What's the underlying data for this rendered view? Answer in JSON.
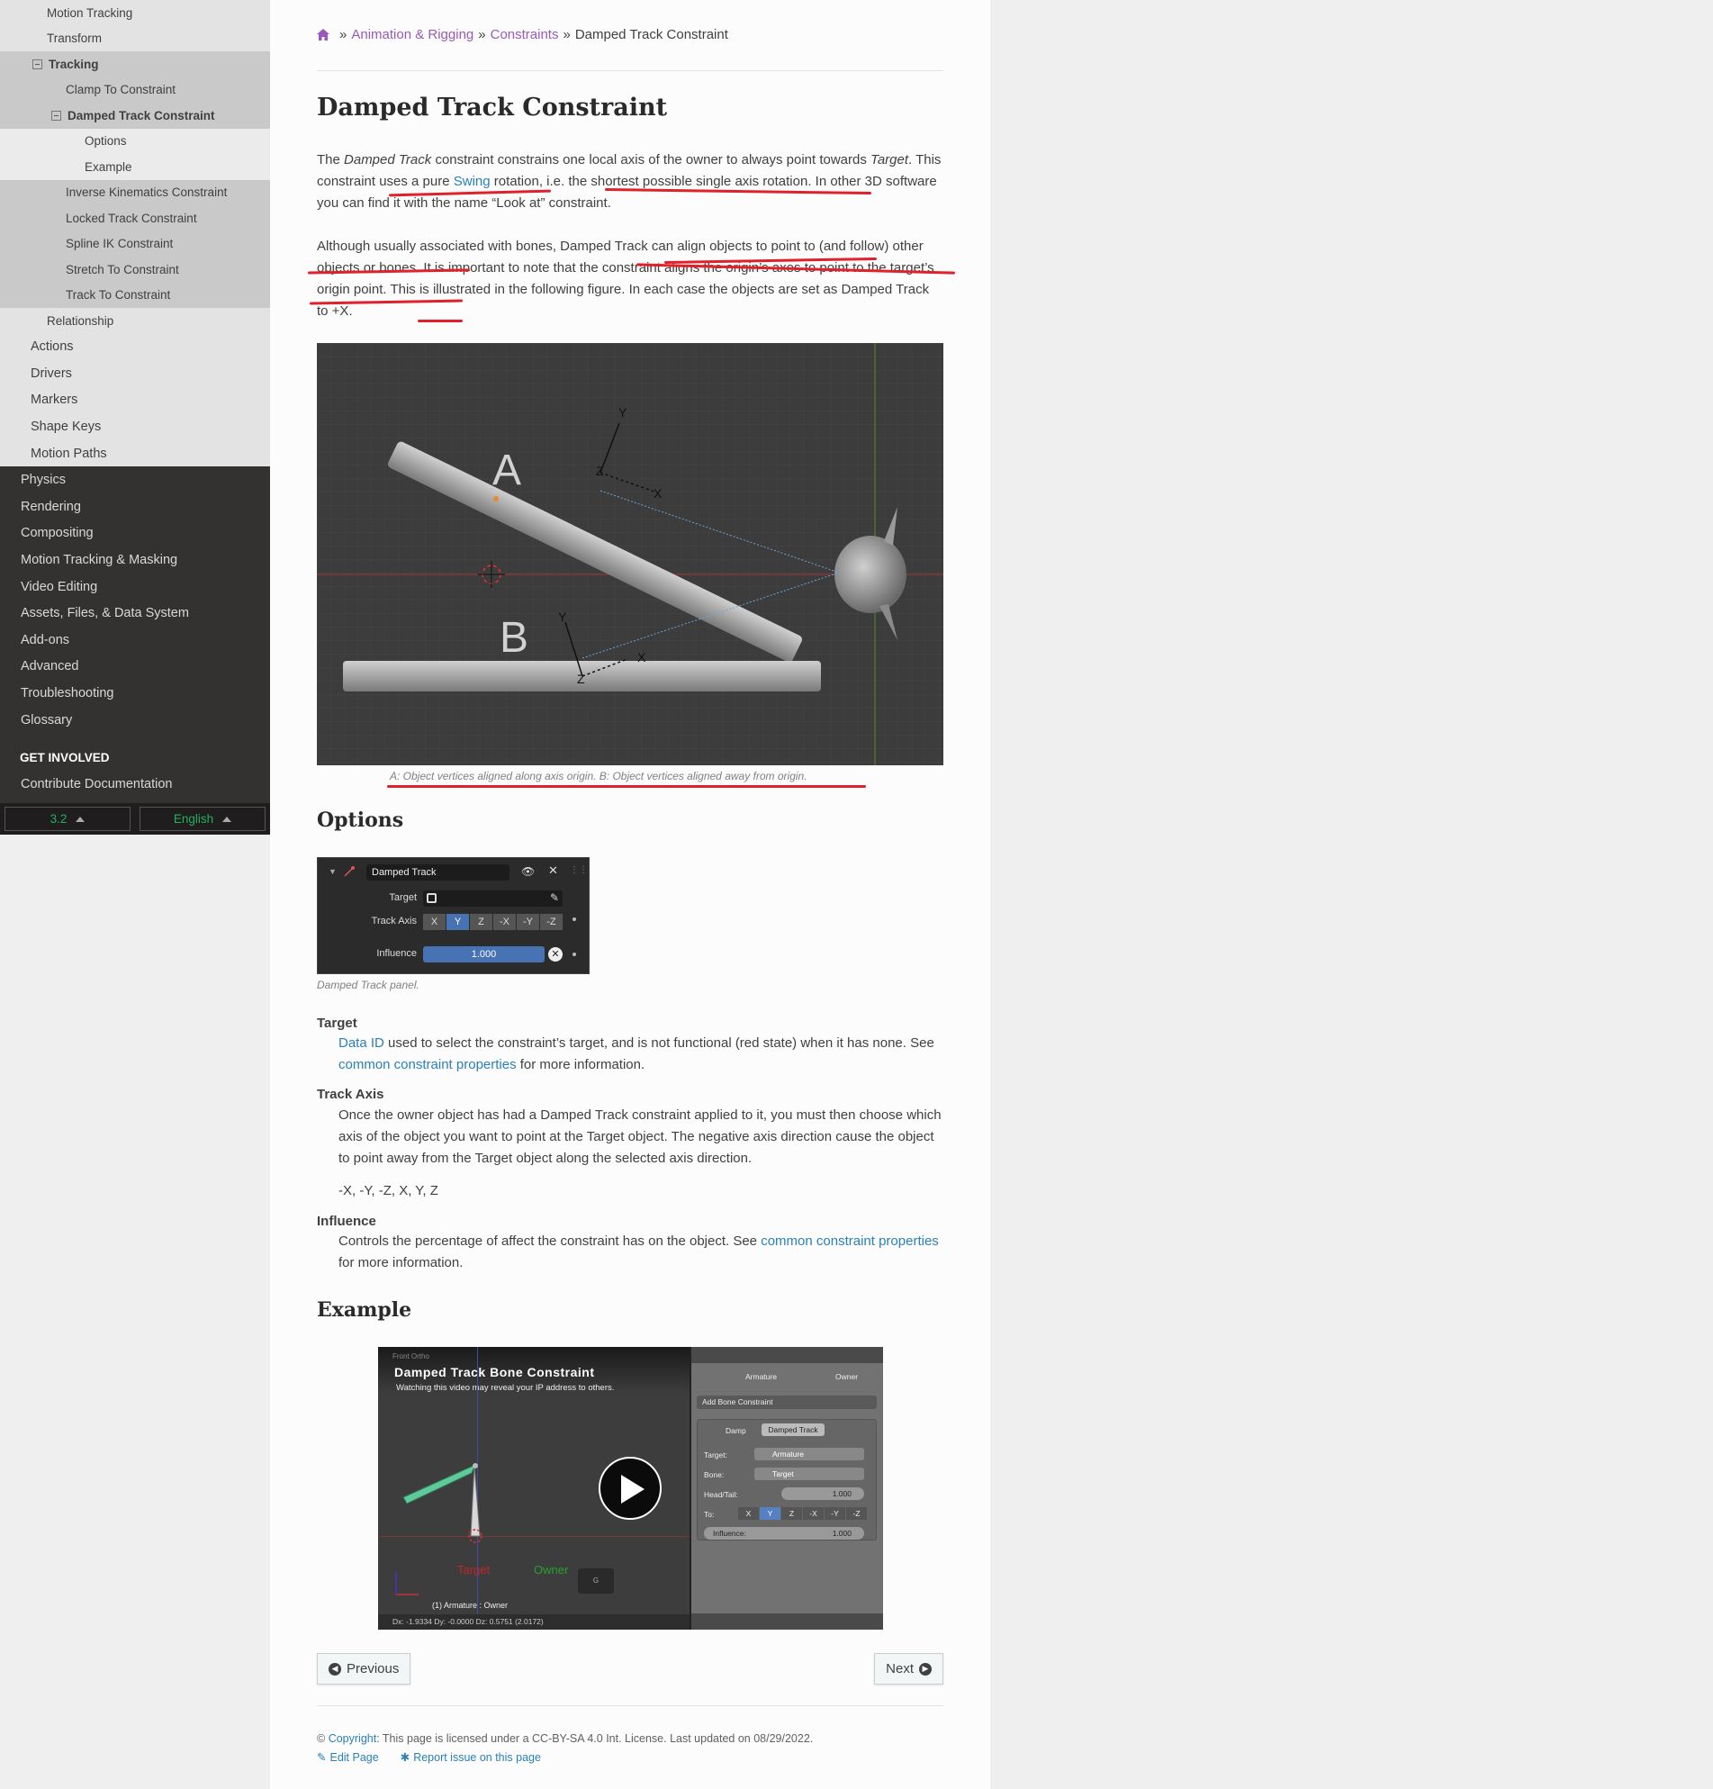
{
  "sidebar": {
    "level2_a": [
      "Motion Tracking",
      "Transform"
    ],
    "tracking": "Tracking",
    "clamp": "Clamp To Constraint",
    "damped": "Damped Track Constraint",
    "sub": [
      "Options",
      "Example"
    ],
    "level3_rest": [
      "Inverse Kinematics Constraint",
      "Locked Track Constraint",
      "Spline IK Constraint",
      "Stretch To Constraint",
      "Track To Constraint"
    ],
    "relationship": "Relationship",
    "level1": [
      "Actions",
      "Drivers",
      "Markers",
      "Shape Keys",
      "Motion Paths"
    ],
    "top": [
      "Physics",
      "Rendering",
      "Compositing",
      "Motion Tracking & Masking",
      "Video Editing",
      "Assets, Files, & Data System",
      "Add-ons",
      "Advanced",
      "Troubleshooting",
      "Glossary"
    ],
    "get_involved": "GET INVOLVED",
    "contribute": "Contribute Documentation",
    "version": "3.2",
    "language": "English"
  },
  "breadcrumb": {
    "sep": "»",
    "items": [
      "Animation & Rigging",
      "Constraints"
    ],
    "current": "Damped Track Constraint"
  },
  "page": {
    "title": "Damped Track Constraint",
    "intro": {
      "p1_a": "The ",
      "p1_em1": "Damped Track",
      "p1_b": " constraint constrains one local axis of the owner to always point towards ",
      "p1_em2": "Target",
      "p1_c": ". This constraint uses a pure ",
      "p1_link": "Swing",
      "p1_d": " rotation, i.e. the shortest possible single axis rotation. In other 3D software you can find it with the name “Look at” constraint.",
      "p2": "Although usually associated with bones, Damped Track can align objects to point to (and follow) other objects or bones. It is important to note that the constraint aligns the origin’s axes to point to the target’s origin point. This is illustrated in the following figure. In each case the objects are set as Damped Track to +X."
    },
    "figure": {
      "label_a": "A",
      "label_b": "B",
      "axis_x": "X",
      "axis_y": "Y",
      "axis_z": "Z",
      "caption": "A: Object vertices aligned along axis origin. B: Object vertices aligned away from origin."
    },
    "options_heading": "Options",
    "panel": {
      "name": "Damped Track",
      "target_label": "Target",
      "track_axis_label": "Track Axis",
      "axes": [
        "X",
        "Y",
        "Z",
        "-X",
        "-Y",
        "-Z"
      ],
      "influence_label": "Influence",
      "influence_value": "1.000",
      "caption": "Damped Track panel."
    },
    "target": {
      "term": "Target",
      "link1": "Data ID",
      "text1": " used to select the constraint’s target, and is not functional (red state) when it has none. See ",
      "link2": "common constraint properties",
      "text2": " for more information."
    },
    "track_axis": {
      "term": "Track Axis",
      "text": "Once the owner object has had a Damped Track constraint applied to it, you must then choose which axis of the object you want to point at the Target object. The negative axis direction cause the object to point away from the Target object along the selected axis direction.",
      "values": "-X, -Y, -Z, X, Y, Z"
    },
    "influence": {
      "term": "Influence",
      "text1": "Controls the percentage of affect the constraint has on the object. See ",
      "link": "common constraint properties",
      "text2": " for more information."
    },
    "example_heading": "Example",
    "video": {
      "corner": "Front Ortho",
      "title": "Damped Track Bone Constraint",
      "notice": "Watching this video may reveal your IP address to others.",
      "armature": "Armature",
      "owner": "Owner",
      "add_bone": "Add Bone Constraint",
      "damp": "Damp",
      "damped_track": "Damped Track",
      "target_lbl": "Target:",
      "target_val": "Armature",
      "bone_lbl": "Bone:",
      "bone_val": "Target",
      "headtail_lbl": "Head/Tail:",
      "headtail_val": "1.000",
      "to_lbl": "To:",
      "axes": [
        "X",
        "Y",
        "Z",
        "-X",
        "-Y",
        "-Z"
      ],
      "influence": "Influence:",
      "influence_val": "1.000",
      "vp_target": "Target",
      "vp_owner": "Owner",
      "vp_g": "G",
      "vp_status": "(1) Armature : Owner",
      "vp_coords": "Dx: -1.9334   Dy: -0.0000   Dz: 0.5751 (2.0172)"
    },
    "previous": "Previous",
    "next": "Next",
    "footer": {
      "copyright_symbol": "©",
      "copyright_link": "Copyright",
      "license": ": This page is licensed under a CC-BY-SA 4.0 Int. License. Last updated on 08/29/2022.",
      "edit": "Edit Page",
      "report": "Report issue on this page"
    }
  },
  "colors": {
    "link": "#2980b9",
    "breadcrumb_link": "#9b59b6",
    "annotation": "#e0202a",
    "version_text": "#27ae60"
  }
}
